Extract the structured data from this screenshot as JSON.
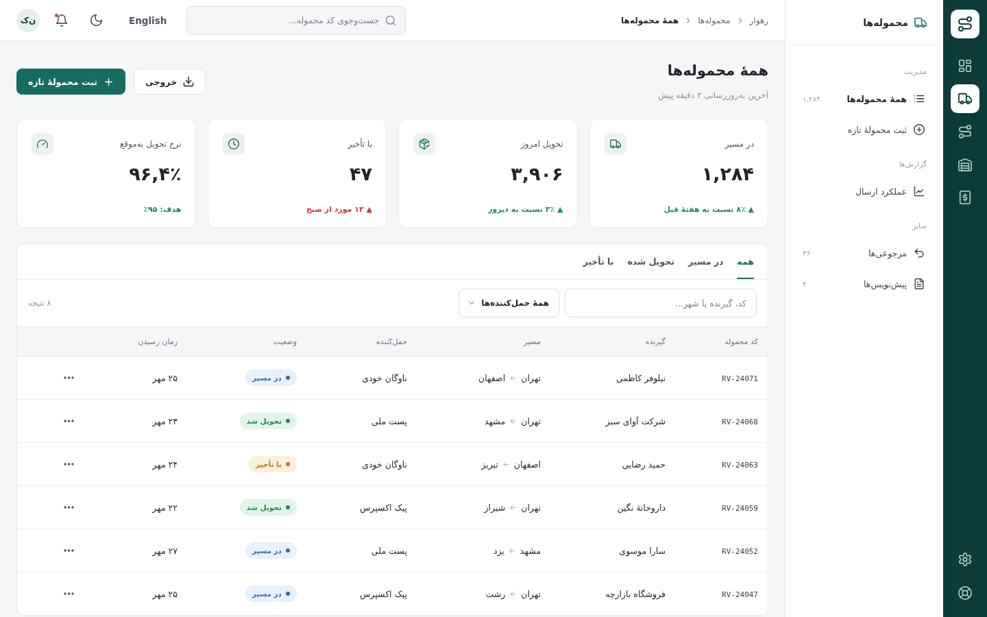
{
  "rail": {
    "items": [
      {
        "selected": false
      },
      {
        "selected": true
      },
      {
        "selected": false
      },
      {
        "selected": false
      },
      {
        "selected": false
      }
    ],
    "footer_items": [
      {
        "selected": false
      },
      {
        "selected": false
      }
    ]
  },
  "sidebar": {
    "title": "محموله‌ها",
    "sections": [
      {
        "label": "مدیریت",
        "items": [
          {
            "label": "همهٔ محموله‌ها",
            "count": "۱,۲۸۴",
            "selected": true
          },
          {
            "label": "ثبت محمولهٔ تازه",
            "selected": false
          }
        ]
      },
      {
        "label": "گزارش‌ها",
        "items": [
          {
            "label": "عملکرد ارسال",
            "selected": false
          }
        ]
      },
      {
        "label": "سایر",
        "items": [
          {
            "label": "مرجوعی‌ها",
            "count": "۳۶",
            "selected": false
          },
          {
            "label": "پیش‌نویس‌ها",
            "count": "۴",
            "selected": false
          }
        ]
      }
    ]
  },
  "top_bar": {
    "breadcrumb": [
      "رهوار",
      "محموله‌ها",
      "همهٔ محموله‌ها"
    ],
    "search": {
      "placeholder": "جست‌وجوی کد محموله..."
    },
    "language": "English",
    "notifications": {
      "unread": true
    },
    "avatar": "ن‌ک"
  },
  "page_header": {
    "title": "همهٔ محموله‌ها",
    "subtitle": "آخرین به‌روزرسانی ۲ دقیقه پیش",
    "actions": [
      {
        "label": "خروجی",
        "kind": "secondary"
      },
      {
        "label": "ثبت محمولهٔ تازه",
        "kind": "primary"
      }
    ]
  },
  "stats": [
    {
      "label": "در مسیر",
      "value": "۱,۲۸۴",
      "delta": "▲ ۸٪ نسبت به هفتهٔ قبل",
      "color": "#1e8a4f"
    },
    {
      "label": "تحویل امروز",
      "value": "۳,۹۰۶",
      "delta": "▲ ۳٪ نسبت به دیروز",
      "color": "#1e8a4f"
    },
    {
      "label": "با تأخیر",
      "value": "۴۷",
      "delta": "▲ ۱۲ مورد از صبح",
      "color": "#c93b3b"
    },
    {
      "label": "نرخ تحویل به‌موقع",
      "value": "۹۶,۴٪",
      "delta": "هدف: ۹۵٪",
      "color": "#1e8a4f"
    }
  ],
  "shipments": {
    "tabs": [
      {
        "label": "همه",
        "selected": true
      },
      {
        "label": "در مسیر",
        "selected": false
      },
      {
        "label": "تحویل شده",
        "selected": false
      },
      {
        "label": "با تأخیر",
        "selected": false
      }
    ],
    "filter": {
      "placeholder": "کد، گیرنده یا شهر...",
      "carrier": "همهٔ حمل‌کننده‌ها",
      "result_count": "۸ نتیجه"
    },
    "columns": [
      "کد محموله",
      "گیرنده",
      "مسیر",
      "حمل‌کننده",
      "وضعیت",
      "زمان رسیدن"
    ],
    "rows": [
      {
        "code": "RV-24071",
        "recipient": "نیلوفر کاظمی",
        "from": "تهران",
        "to": "اصفهان",
        "carrier": "ناوگان خودی",
        "status": {
          "kind": "in_transit",
          "label": "در مسیر"
        },
        "eta": "۲۵ مهر"
      },
      {
        "code": "RV-24068",
        "recipient": "شرکت آوای سبز",
        "from": "تهران",
        "to": "مشهد",
        "carrier": "پست ملی",
        "status": {
          "kind": "delivered",
          "label": "تحویل شد"
        },
        "eta": "۲۳ مهر"
      },
      {
        "code": "RV-24063",
        "recipient": "حمید رضایی",
        "from": "اصفهان",
        "to": "تبریز",
        "carrier": "ناوگان خودی",
        "status": {
          "kind": "delayed",
          "label": "با تأخیر"
        },
        "eta": "۲۴ مهر"
      },
      {
        "code": "RV-24059",
        "recipient": "داروخانهٔ نگین",
        "from": "تهران",
        "to": "شیراز",
        "carrier": "پیک اکسپرس",
        "status": {
          "kind": "delivered",
          "label": "تحویل شد"
        },
        "eta": "۲۲ مهر"
      },
      {
        "code": "RV-24052",
        "recipient": "سارا موسوی",
        "from": "مشهد",
        "to": "یزد",
        "carrier": "پست ملی",
        "status": {
          "kind": "in_transit",
          "label": "در مسیر"
        },
        "eta": "۲۷ مهر"
      },
      {
        "code": "RV-24047",
        "recipient": "فروشگاه بازارچه",
        "from": "تهران",
        "to": "رشت",
        "carrier": "پیک اکسپرس",
        "status": {
          "kind": "in_transit",
          "label": "در مسیر"
        },
        "eta": "۲۵ مهر"
      }
    ]
  }
}
